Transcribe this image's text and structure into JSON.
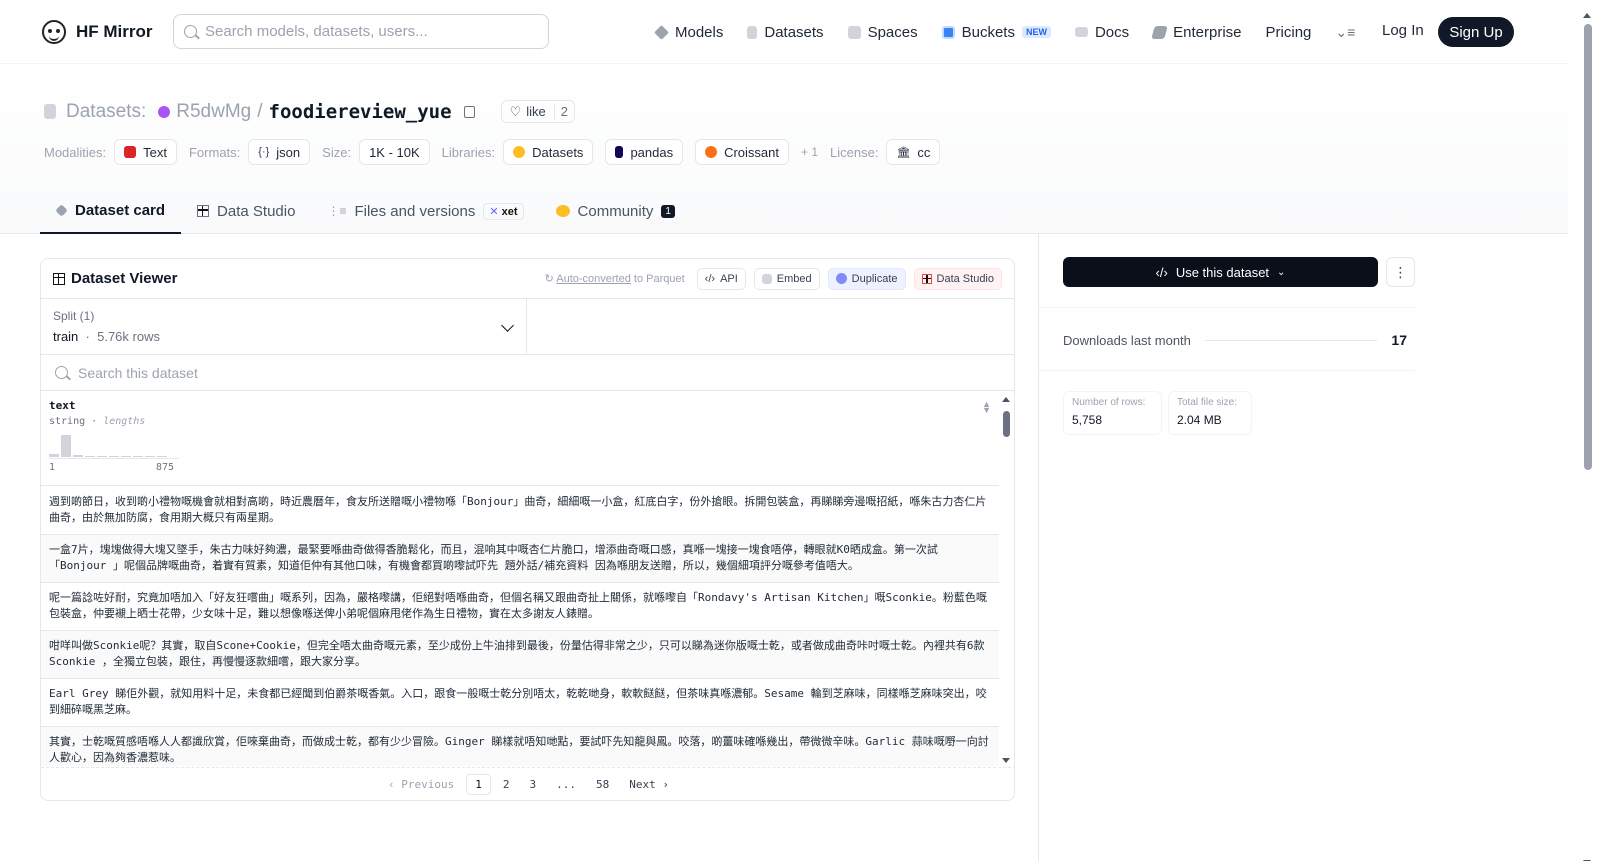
{
  "nav": {
    "brand": "HF Mirror",
    "search_placeholder": "Search models, datasets, users...",
    "links": [
      {
        "label": "Models",
        "icon": "models-icon"
      },
      {
        "label": "Datasets",
        "icon": "datasets-icon"
      },
      {
        "label": "Spaces",
        "icon": "spaces-icon"
      },
      {
        "label": "Buckets",
        "icon": "buckets-icon",
        "badge": "NEW"
      },
      {
        "label": "Docs",
        "icon": "docs-icon"
      },
      {
        "label": "Enterprise",
        "icon": "enterprise-icon"
      },
      {
        "label": "Pricing"
      }
    ],
    "login": "Log In",
    "signup": "Sign Up"
  },
  "header": {
    "prefix": "Datasets:",
    "owner": "R5dwMg",
    "separator": "/",
    "name": "foodiereview_yue",
    "like_label": "like",
    "like_count": "2"
  },
  "meta": {
    "modalities_label": "Modalities:",
    "modality": "Text",
    "formats_label": "Formats:",
    "format": "json",
    "size_label": "Size:",
    "size": "1K - 10K",
    "libraries_label": "Libraries:",
    "libraries": [
      "Datasets",
      "pandas",
      "Croissant"
    ],
    "more_libraries": "+ 1",
    "license_label": "License:",
    "license": "cc"
  },
  "tabs": {
    "card": "Dataset card",
    "studio": "Data Studio",
    "files": "Files and versions",
    "xet": "xet",
    "community": "Community",
    "community_count": "1"
  },
  "viewer": {
    "title": "Dataset Viewer",
    "auto_converted": "Auto-converted",
    "to_parquet": "to Parquet",
    "api": "API",
    "embed": "Embed",
    "duplicate": "Duplicate",
    "data_studio": "Data Studio",
    "split_label": "Split (1)",
    "split_name": "train",
    "split_rows": "5.76k rows",
    "search_placeholder": "Search this dataset",
    "column": {
      "name": "text",
      "type": "string",
      "stat": "lengths",
      "min": "1",
      "max": "875"
    },
    "histogram": [
      0.15,
      1.0,
      0.1,
      0,
      0,
      0,
      0,
      0,
      0,
      0
    ],
    "rows": [
      "週到啲節日，收到啲小禮物嘅機會就相對高啲，時近農曆年，食友所送贈嘅小禮物喺「Bonjour」曲奇，細細嘅一小盒，紅底白字，份外搶眼。拆開包裝盒，再睇睇旁邊嘅招紙，喺朱古力杏仁片曲奇，由於無加防腐，食用期大概只有兩星期。",
      "一盒7片，塊塊做得大塊又墜手，朱古力味好夠濃，最緊要喺曲奇做得香脆鬆化，而且，混响其中嘅杏仁片脆口，增添曲奇嘅口感，真喺一塊接一塊食唔停，轉眼就K0晒成盒。第一次試「Bonjour 」呢個品牌嘅曲奇，着實有質素，知道佢仲有其他口味，有機會都買啲嚟試吓先 題外話/補充資料 因為喺朋友送贈，所以，幾個細項評分嘅參考值唔大。",
      "呢一篇諗咗好耐，究竟加唔加入「好友狂嚐曲」嘅系列，因為，嚴格嚟講，佢絕對唔喺曲奇，但個名稱又跟曲奇扯上關係，就喺嚟自「Rondavy's Artisan Kitchen」嘅Sconkie。粉藍色嘅包裝盒，仲要襯上晒士花帶，少女味十足，難以想像喺送俾小弟呢個麻甩佬作為生日禮物，實在太多謝友人錶贈。",
      "咁咩叫做Sconkie呢？其實，取自Scone+Cookie，但完全唔太曲奇嘅元素，至少成份上牛油排到最後，份量估得非常之少，只可以睇為迷你版嘅士乾，或者做成曲奇咔吋嘅士乾。內裡共有6款Sconkie ，全獨立包裝，跟住，再慢慢逐款細嚐，跟大家分享。",
      "Earl Grey 睇佢外觀，就知用料十足，未食都已經聞到伯爵茶嘅香氣。入口，跟食一般嘅士乾分別唔太，乾乾哋身，軟軟餸餸，但茶味真喺濃郁。Sesame 輪到芝麻味，同樣喺芝麻味突出，咬到細碎嘅黑芝麻。",
      "其實，士乾嘅質感唔喺人人都識欣賞，佢唻棄曲奇，而做成士乾，都有少少冒險。Ginger 睇樣就唔知哋點，要試吓先知龍與鳳。咬落，啲薑味確喺幾出，帶微微辛味。Garlic 蒜味嘅嘢一向討人歡心，因為夠香濃惹味。"
    ],
    "pager": {
      "prev": "Previous",
      "pages": [
        "1",
        "2",
        "3",
        "...",
        "58"
      ],
      "next": "Next"
    }
  },
  "side": {
    "use_button": "Use this dataset",
    "downloads_label": "Downloads last month",
    "downloads_value": "17",
    "rows_label": "Number of rows:",
    "rows_value": "5,758",
    "size_label": "Total file size:",
    "size_value": "2.04 MB"
  },
  "colors": {
    "accent": "#111827",
    "owner_avatar": "#a855f7"
  }
}
